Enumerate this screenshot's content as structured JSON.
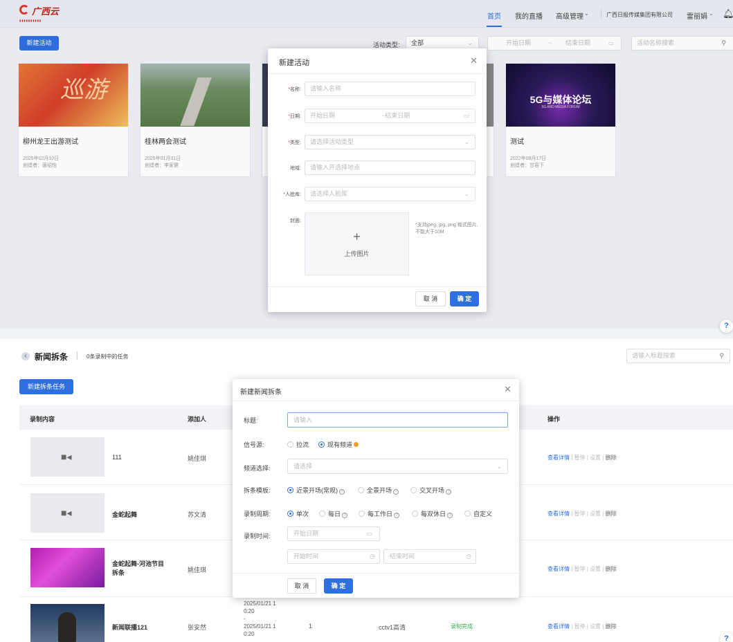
{
  "header": {
    "logo_text": "广西云",
    "logo_sub": "▮▮▮▮▮▮▮▮▮▮",
    "nav": [
      "首页",
      "我的直播",
      "高级管理"
    ],
    "org": "广西日报传媒集团有限公司",
    "user": "雷丽娟"
  },
  "activity": {
    "new_button": "新建活动",
    "filter_label": "活动类型:",
    "filter_value": "全部",
    "start_placeholder": "开始日期",
    "date_sep": "~",
    "end_placeholder": "结束日期",
    "search_placeholder": "活动名称搜索",
    "cards": [
      {
        "title": "柳州龙王出游测试",
        "date": "2025年02月10日",
        "creator": "创建者：唐绍怡"
      },
      {
        "title": "桂林两会测试",
        "date": "2025年01月01日",
        "creator": "创建者：李家健"
      },
      {
        "title": "测试",
        "date": "2022年08月17日",
        "creator": "创建者：甘容下"
      }
    ],
    "card4_banner_title": "5G与媒体论坛",
    "card4_banner_sub": "5G AND MEDIA FORUM"
  },
  "dialog1": {
    "title": "新建活动",
    "name_label": "名称:",
    "name_placeholder": "请输入名称",
    "date_label": "日期:",
    "date_start": "开始日期",
    "date_end": "~结束日期",
    "type_label": "类型:",
    "type_placeholder": "请选择活动类型",
    "place_label": "地域:",
    "place_placeholder": "请输入开选择地点",
    "face_label": "人脸库:",
    "face_placeholder": "请选择人脸库",
    "cover_label": "封面:",
    "upload_plus": "+",
    "upload_text": "上传图片",
    "upload_hint": "*支持jpeg, jpg, png 格式图片, 不能大于10M",
    "cancel": "取 消",
    "ok": "确 定"
  },
  "news": {
    "back_icon": "‹",
    "title": "新闻拆条",
    "count": "0条录制中的任务",
    "search_placeholder": "请输入标题搜索",
    "new_button": "新建拆条任务",
    "columns": [
      "录制内容",
      "添加人",
      "操作"
    ],
    "rows": [
      {
        "name": "111",
        "user": "姚佳琪"
      },
      {
        "name": "金蛇起舞",
        "user": "苏文清"
      },
      {
        "name": "金蛇起舞-河池节目拆条",
        "user": "姚佳琪"
      },
      {
        "name": "新闻联播121",
        "user": "张安然",
        "time1": "2025/01/21 1",
        "time2": "0:20",
        "dash": "-",
        "time3": "2025/01/21 1",
        "time4": "0:20",
        "count": "1",
        "channel": "cctv1高清",
        "status": "录制完成"
      }
    ],
    "op_view": "查看详情",
    "op_pause": "暂停",
    "op_set": "设置",
    "op_delete": "删除"
  },
  "dialog2": {
    "title": "新建新闻拆条",
    "title_label": "标题:",
    "title_placeholder": "请输入",
    "source_label": "信号源:",
    "source_pull": "拉流",
    "source_channel": "现有频道",
    "channel_label": "频道选择:",
    "channel_placeholder": "请选择",
    "template_label": "拆条模板:",
    "tpl1": "近景开场(常规)",
    "tpl2": "全景开场",
    "tpl3": "交叉开场",
    "period_label": "录制周期:",
    "p1": "单次",
    "p2": "每日",
    "p3": "每工作日",
    "p4": "每双休日",
    "p5": "自定义",
    "time_label": "录制时间:",
    "date_placeholder": "开始日期",
    "start_time": "开始时间",
    "end_time": "结束时间",
    "cancel": "取 消",
    "ok": "确 定"
  },
  "help": "?"
}
